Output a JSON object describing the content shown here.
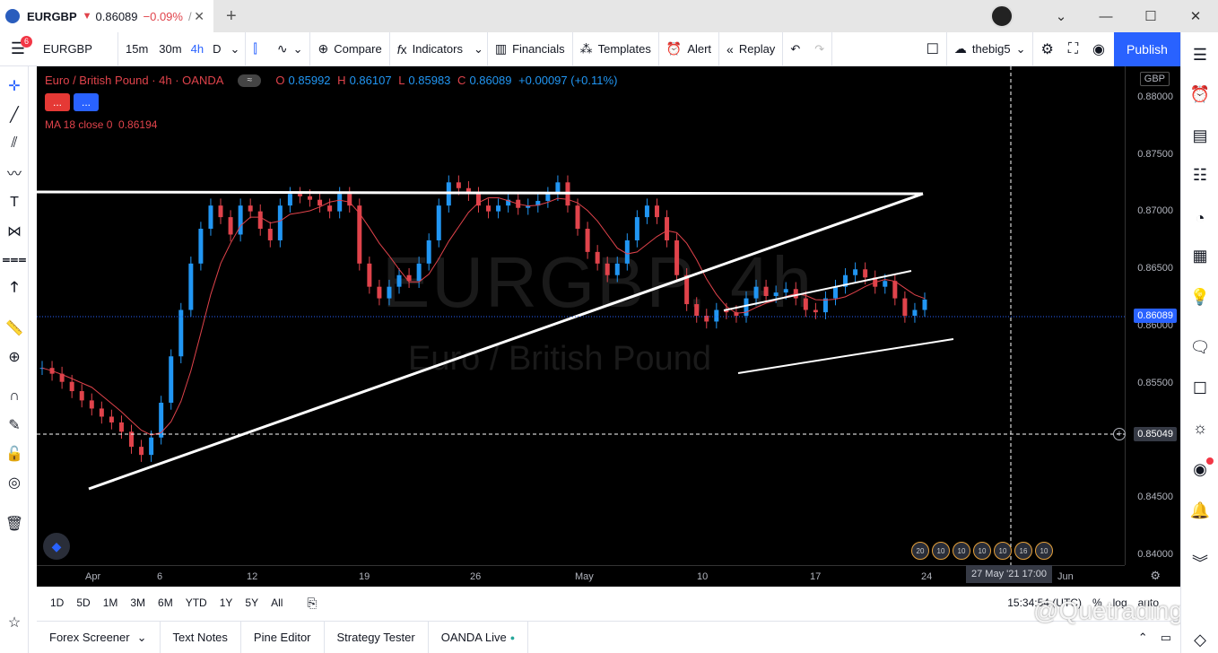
{
  "tab": {
    "symbol": "EURGBP",
    "arrow": "▼",
    "price": "0.86089",
    "change": "−0.09%",
    "divider": "/",
    "close": "✕",
    "new_tab": "+"
  },
  "window": {
    "minimize": "—",
    "maximize": "☐",
    "close": "✕",
    "menu_chevron": "⌄"
  },
  "toolbar": {
    "menu_badge": "6",
    "symbol": "EURGBP",
    "intervals": [
      "15m",
      "30m",
      "4h",
      "D"
    ],
    "active_interval": "4h",
    "compare_label": "Compare",
    "indicators_label": "Indicators",
    "financials_label": "Financials",
    "templates_label": "Templates",
    "alert_label": "Alert",
    "replay_label": "Replay",
    "layout_name": "thebig5",
    "publish_label": "Publish"
  },
  "legend": {
    "title": "Euro / British Pound · 4h · OANDA",
    "pill": "≈",
    "o_key": "O",
    "o_val": "0.85992",
    "h_key": "H",
    "h_val": "0.86107",
    "l_key": "L",
    "l_val": "0.85983",
    "c_key": "C",
    "c_val": "0.86089",
    "change": "+0.00097 (+0.11%)",
    "btn1": "...",
    "btn2": "...",
    "ma": "MA 18 close 0",
    "ma_val": "0.86194"
  },
  "watermark": {
    "symbol": "EURGBP, 4h",
    "name": "Euro / British Pound"
  },
  "price_axis": {
    "currency": "GBP",
    "labels": [
      "0.88000",
      "0.87500",
      "0.87000",
      "0.86500",
      "0.86000",
      "0.85500",
      "0.85000",
      "0.84500",
      "0.84000"
    ],
    "current": "0.86089",
    "crosshair": "0.85049"
  },
  "time_axis": {
    "labels": [
      "Apr",
      "6",
      "12",
      "19",
      "26",
      "May",
      "10",
      "17",
      "24",
      "Jun"
    ],
    "crosshair": "27 May '21   17:00"
  },
  "events": [
    "20",
    "10",
    "10",
    "10",
    "10",
    "16",
    "10"
  ],
  "range_bar": {
    "ranges": [
      "1D",
      "5D",
      "1M",
      "3M",
      "6M",
      "YTD",
      "1Y",
      "5Y",
      "All"
    ],
    "clock": "15:34:54 (UTC)",
    "percent": "%",
    "log": "log",
    "auto": "auto"
  },
  "bottom_tabs": [
    "Forex Screener",
    "Text Notes",
    "Pine Editor",
    "Strategy Tester",
    "OANDA Live"
  ],
  "bottom_watermark": "@Quetrading",
  "chart_data": {
    "type": "candlestick",
    "title": "Euro / British Pound · 4h · OANDA",
    "ylim": [
      0.838,
      0.881
    ],
    "x_ticks": [
      "Apr",
      "6",
      "12",
      "19",
      "26",
      "May",
      "10",
      "17",
      "24",
      "Jun"
    ],
    "ma_period": 18,
    "last_close": 0.86089,
    "close_series": [
      0.855,
      0.8545,
      0.8538,
      0.853,
      0.8522,
      0.8515,
      0.8508,
      0.8503,
      0.8495,
      0.8482,
      0.8475,
      0.849,
      0.852,
      0.856,
      0.86,
      0.864,
      0.867,
      0.869,
      0.868,
      0.8665,
      0.869,
      0.8685,
      0.867,
      0.866,
      0.869,
      0.87,
      0.8698,
      0.8695,
      0.869,
      0.8685,
      0.87,
      0.869,
      0.864,
      0.862,
      0.861,
      0.862,
      0.863,
      0.8625,
      0.864,
      0.866,
      0.869,
      0.871,
      0.8705,
      0.87,
      0.869,
      0.8685,
      0.869,
      0.8695,
      0.8688,
      0.869,
      0.8694,
      0.87,
      0.871,
      0.869,
      0.867,
      0.865,
      0.864,
      0.863,
      0.864,
      0.866,
      0.868,
      0.869,
      0.868,
      0.866,
      0.863,
      0.8605,
      0.8595,
      0.859,
      0.86,
      0.8598,
      0.8595,
      0.861,
      0.862,
      0.8612,
      0.8615,
      0.8618,
      0.861,
      0.86,
      0.8598,
      0.861,
      0.862,
      0.863,
      0.8635,
      0.8628,
      0.862,
      0.8625,
      0.861,
      0.8595,
      0.86,
      0.8609
    ]
  }
}
